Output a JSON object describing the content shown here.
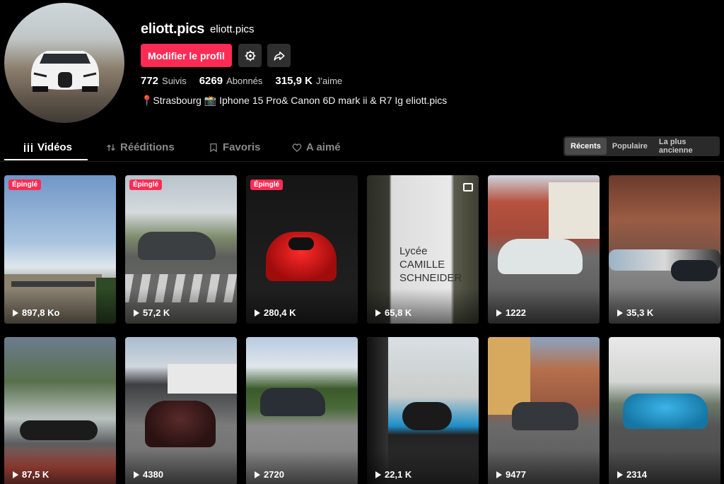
{
  "profile": {
    "username": "eliott.pics",
    "nickname": "eliott.pics",
    "edit_label": "Modifier le profil",
    "stats": [
      {
        "value": "772",
        "label": "Suivis"
      },
      {
        "value": "6269",
        "label": "Abonnés"
      },
      {
        "value": "315,9 K",
        "label": "J'aime"
      }
    ],
    "bio": "📍Strasbourg 📸 Iphone 15 Pro& Canon 6D mark ii & R7 Ig eliott.pics"
  },
  "tabs": [
    {
      "label": "Vidéos",
      "icon": "grid-bars-icon"
    },
    {
      "label": "Rééditions",
      "icon": "repost-icon"
    },
    {
      "label": "Favoris",
      "icon": "bookmark-icon"
    },
    {
      "label": "A aimé",
      "icon": "heart-outline-icon"
    }
  ],
  "sort": [
    {
      "label": "Récents",
      "active": true
    },
    {
      "label": "Populaire",
      "active": false
    },
    {
      "label": "La plus ancienne",
      "active": false
    }
  ],
  "videos": [
    {
      "views": "897,8 Ko",
      "pinned": "Épinglé"
    },
    {
      "views": "57,2 K",
      "pinned": "Épinglé"
    },
    {
      "views": "280,4 K",
      "pinned": "Épinglé"
    },
    {
      "views": "65,8 K",
      "overlay": "Lycée CAMILLE SCHNEIDER"
    },
    {
      "views": "1222"
    },
    {
      "views": "35,3 K"
    },
    {
      "views": "87,5 K"
    },
    {
      "views": "4380"
    },
    {
      "views": "2720"
    },
    {
      "views": "22,1 K"
    },
    {
      "views": "9477"
    },
    {
      "views": "2314"
    }
  ],
  "colors": {
    "accent": "#fe2c55",
    "background": "#000000"
  }
}
